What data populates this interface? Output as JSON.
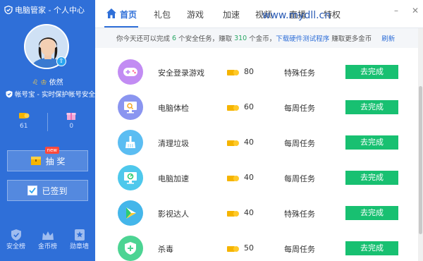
{
  "app": {
    "title": "电脑管家 - 个人中心"
  },
  "user": {
    "name": "依然",
    "security_text": "帐号宝 - 实时保护帐号安全"
  },
  "stats": {
    "coins": "61",
    "gifts": "0"
  },
  "sidebar_buttons": {
    "lottery": "抽 奖",
    "lottery_tag": "new",
    "checkin": "已签到"
  },
  "sidebar_bottom": [
    {
      "label": "安全榜",
      "icon": "shield-check-icon"
    },
    {
      "label": "金币榜",
      "icon": "crown-icon"
    },
    {
      "label": "勋章墙",
      "icon": "medal-icon"
    }
  ],
  "tabs": [
    "首页",
    "礼包",
    "游戏",
    "加速",
    "视频",
    "直播",
    "特权"
  ],
  "window_controls": {
    "minimize": "–",
    "close": "✕"
  },
  "watermark": "www.mydll.cn",
  "notice": {
    "part1": "你今天还可以完成",
    "tasks_left": "6",
    "part2": "个安全任务，赚取",
    "coins": "310",
    "part3": "个金币，",
    "link": "下载硬件测试程序",
    "part4": "赚取更多金币",
    "refresh": "刷新"
  },
  "tasks": [
    {
      "name": "安全登录游戏",
      "reward": "80",
      "type": "特殊任务",
      "action": "去完成",
      "icon": "gamepad-icon",
      "color": "#b07df0"
    },
    {
      "name": "电脑体检",
      "reward": "60",
      "type": "每周任务",
      "action": "去完成",
      "icon": "monitor-check-icon",
      "color": "#7b86ee"
    },
    {
      "name": "清理垃圾",
      "reward": "40",
      "type": "每周任务",
      "action": "去完成",
      "icon": "broom-icon",
      "color": "#4ab3f0"
    },
    {
      "name": "电脑加速",
      "reward": "40",
      "type": "每周任务",
      "action": "去完成",
      "icon": "speed-monitor-icon",
      "color": "#3cc3e8"
    },
    {
      "name": "影视达人",
      "reward": "40",
      "type": "特殊任务",
      "action": "去完成",
      "icon": "video-play-icon",
      "color": "#39b0e8"
    },
    {
      "name": "杀毒",
      "reward": "50",
      "type": "每周任务",
      "action": "去完成",
      "icon": "shield-plus-icon",
      "color": "#3ccf8a"
    }
  ],
  "colors": {
    "sidebar": "#2f6fd8",
    "accent": "#2f6fd8",
    "button": "#18c071",
    "coin": "#f5b400"
  }
}
